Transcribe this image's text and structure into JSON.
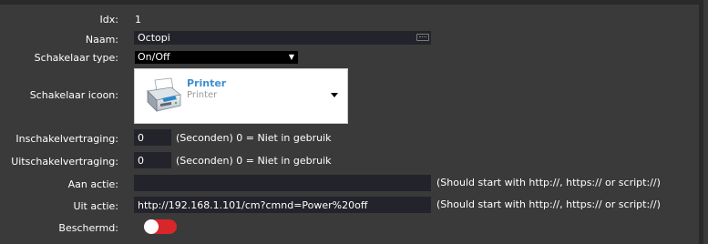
{
  "form": {
    "idx": {
      "label": "Idx:",
      "value": "1"
    },
    "name": {
      "label": "Naam:",
      "value": "Octopi",
      "icon": "keyboard-icon"
    },
    "switch_type": {
      "label": "Schakelaar type:",
      "value": "On/Off"
    },
    "switch_icon": {
      "label": "Schakelaar icoon:",
      "title": "Printer",
      "subtitle": "Printer",
      "icon": "printer-icon"
    },
    "on_delay": {
      "label": "Inschakelvertraging:",
      "value": "0",
      "hint": "(Seconden) 0 = Niet in gebruik"
    },
    "off_delay": {
      "label": "Uitschakelvertraging:",
      "value": "0",
      "hint": "(Seconden) 0 = Niet in gebruik"
    },
    "on_action": {
      "label": "Aan actie:",
      "value": "",
      "hint": "(Should start with http://, https:// or script://)"
    },
    "off_action": {
      "label": "Uit actie:",
      "value": "http://192.168.1.101/cm?cmnd=Power%20off",
      "hint": "(Should start with http://, https:// or script://)"
    },
    "protected": {
      "label": "Beschermd:",
      "checked": false,
      "color": "#d9262a"
    }
  },
  "colors": {
    "background": "#3a3a3a",
    "input_bg": "#23232b",
    "accent": "#3c8fd0"
  }
}
